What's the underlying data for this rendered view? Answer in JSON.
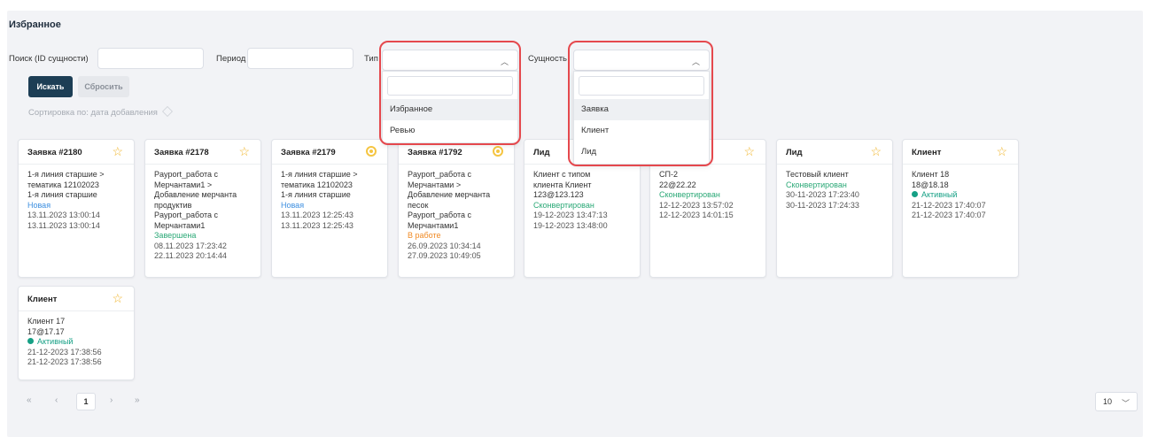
{
  "page": {
    "title": "Избранное"
  },
  "filters": {
    "search_label": "Поиск (ID сущности)",
    "search_value": "",
    "period_label": "Период",
    "period_value": "",
    "type_label": "Тип",
    "type_value": "",
    "entity_label": "Сущность",
    "entity_value": "",
    "search_button": "Искать",
    "reset_button": "Сбросить",
    "sort_text": "Сортировка по:  дата добавления"
  },
  "type_dropdown": {
    "search_value": "",
    "options": [
      "Избранное",
      "Ревью"
    ]
  },
  "entity_dropdown": {
    "search_value": "",
    "options": [
      "Заявка",
      "Клиент",
      "Лид"
    ]
  },
  "cards": [
    {
      "title": "Заявка #2180",
      "icon": "star-icon",
      "lines": [
        "1-я линия старшие >",
        "тематика 12102023",
        "1-я линия старшие"
      ],
      "status": "Новая",
      "status_color": "#3d8fe0",
      "dates": [
        "13.11.2023 13:00:14",
        "13.11.2023 13:00:14"
      ]
    },
    {
      "title": "Заявка #2178",
      "icon": "star-icon",
      "lines": [
        "Payport_работа с",
        "Мерчантами1 >",
        "Добавление мерчанта",
        "продуктив",
        "Payport_работа с",
        "Мерчантами1"
      ],
      "status": "Завершена",
      "status_color": "#2aa876",
      "dates": [
        "08.11.2023 17:23:42",
        "22.11.2023 20:14:44"
      ]
    },
    {
      "title": "Заявка #2179",
      "icon": "target-icon",
      "lines": [
        "1-я линия старшие >",
        "тематика 12102023",
        "1-я линия старшие"
      ],
      "status": "Новая",
      "status_color": "#3d8fe0",
      "dates": [
        "13.11.2023 12:25:43",
        "13.11.2023 12:25:43"
      ]
    },
    {
      "title": "Заявка #1792",
      "icon": "target-icon",
      "lines": [
        "Payport_работа с",
        "Мерчантами >",
        "Добавление мерчанта",
        "песок",
        "Payport_работа с",
        "Мерчантами1"
      ],
      "status": "В работе",
      "status_color": "#f08a24",
      "dates": [
        "26.09.2023 10:34:14",
        "27.09.2023 10:49:05"
      ]
    },
    {
      "title": "Лид",
      "icon": "",
      "lines": [
        "Клиент с типом",
        "клиента Клиент",
        "123@123.123"
      ],
      "status": "Сконвертирован",
      "status_color": "#2aa876",
      "dates": [
        "19-12-2023 13:47:13",
        "19-12-2023 13:48:00"
      ]
    },
    {
      "title": "",
      "icon": "star-icon",
      "lines": [
        "СП-2",
        "22@22.22"
      ],
      "status": "Сконвертирован",
      "status_color": "#2aa876",
      "dates": [
        "12-12-2023 13:57:02",
        "12-12-2023 14:01:15"
      ]
    },
    {
      "title": "Лид",
      "icon": "star-icon",
      "lines": [
        "Тестовый клиент"
      ],
      "status": "Сконвертирован",
      "status_color": "#2aa876",
      "dates": [
        "30-11-2023 17:23:40",
        "30-11-2023 17:24:33"
      ]
    },
    {
      "title": "Клиент",
      "icon": "star-icon",
      "lines": [
        "Клиент 18",
        "18@18.18"
      ],
      "status": "Активный",
      "status_color": "#16a085",
      "status_dot": true,
      "dates": [
        "21-12-2023 17:40:07",
        "21-12-2023 17:40:07"
      ]
    },
    {
      "title": "Клиент",
      "icon": "star-icon",
      "lines": [
        "Клиент 17",
        "17@17.17"
      ],
      "status": "Активный",
      "status_color": "#16a085",
      "status_dot": true,
      "dates": [
        "21-12-2023 17:38:56",
        "21-12-2023 17:38:56"
      ]
    }
  ],
  "pagination": {
    "first": "«",
    "prev": "‹",
    "current": "1",
    "next": "›",
    "last": "»",
    "per_page": "10"
  },
  "colors": {
    "primary_button": "#1d3e55",
    "highlight_border": "#e5484d",
    "star": "#f0b429"
  }
}
